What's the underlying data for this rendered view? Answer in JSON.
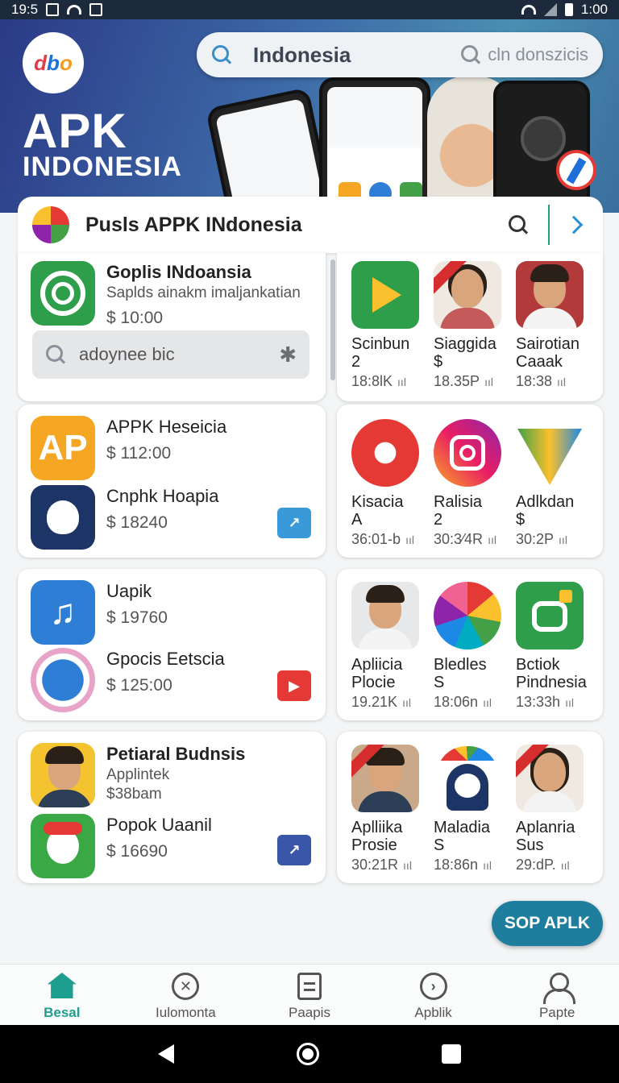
{
  "status_bar": {
    "time": "19:5",
    "right_text": "1:00"
  },
  "header": {
    "brand_line1": "APK",
    "brand_line2": "INDONESIA",
    "logo_text": [
      "d",
      "b",
      "o"
    ],
    "search": {
      "value": "Indonesia",
      "hint": "cln donszicis"
    }
  },
  "title_card": {
    "title": "Pusls APPK INdonesia"
  },
  "featured": {
    "name": "Goplis INdoansia",
    "subtitle": "Saplds ainakm imaljankatian",
    "price": "$  10:00",
    "search_value": "adoynee bic"
  },
  "left_cards": [
    {
      "apps": [
        {
          "name": "APPK Heseicia",
          "price": "$ 112:00",
          "icon": "ap-letters-icon",
          "color": "#f5a623"
        },
        {
          "name": "Cnphk Hoapia",
          "price": "$ 18240",
          "icon": "apple-icon",
          "color": "#1c3566"
        }
      ],
      "button_icon": "trend-icon",
      "button_color": "#3a9ad9"
    },
    {
      "apps": [
        {
          "name": "Uapik",
          "price": "$ 19760",
          "icon": "music-note-icon",
          "color": "#2e7ed6"
        },
        {
          "name": "Gpocis Eetscia",
          "price": "$ 125:00",
          "icon": "compass-icon",
          "color": "#e8eef4"
        }
      ],
      "button_icon": "play-icon",
      "button_color": "#e53935"
    },
    {
      "apps": [
        {
          "name": "Petiaral Budnsis",
          "sub1": "Applintek",
          "sub2": "$38bam",
          "icon": "person-icon",
          "color": "#f4c430"
        },
        {
          "name": "Popok Uaanil",
          "price": "$ 16690",
          "icon": "mascot-icon",
          "color": "#3aa845"
        }
      ],
      "button_icon": "trend-icon",
      "button_color": "#3a56a8"
    }
  ],
  "right_grids": [
    [
      {
        "name1": "Scinbun",
        "name2": "2",
        "stat": "18:8lK",
        "icon": "play-store-icon"
      },
      {
        "name1": "Siaggida",
        "name2": "$",
        "stat": "18.35P",
        "icon": "woman-portrait-icon"
      },
      {
        "name1": "Sairotian",
        "name2": "Caaak",
        "stat": "18:38",
        "icon": "man-portrait-icon"
      }
    ],
    [
      {
        "name1": "Kisacia",
        "name2": "A",
        "stat": "36:01-b",
        "icon": "camera-icon"
      },
      {
        "name1": "Ralisia",
        "name2": "2",
        "stat": "30:3⁄4R",
        "icon": "instagram-icon"
      },
      {
        "name1": "Adlkdan",
        "name2": "$",
        "stat": "30:2P",
        "icon": "triangle-icon"
      }
    ],
    [
      {
        "name1": "Apliicia",
        "name2": "Plocie",
        "stat": "19.21K",
        "icon": "man-portrait-icon"
      },
      {
        "name1": "Bledles",
        "name2": "S",
        "stat": "18:06n",
        "icon": "pinwheel-icon"
      },
      {
        "name1": "Bctiok",
        "name2": "Pindnesia",
        "stat": "13:33h",
        "icon": "link-icon"
      }
    ],
    [
      {
        "name1": "Aplliika",
        "name2": "Prosie",
        "stat": "30:21R",
        "icon": "man-portrait-icon"
      },
      {
        "name1": "Maladia",
        "name2": "S",
        "stat": "18:86n",
        "icon": "penguin-icon"
      },
      {
        "name1": "Aplanria",
        "name2": "Sus",
        "stat": "29:dP.",
        "icon": "woman-portrait-icon"
      }
    ]
  ],
  "bars_glyph": "ııl",
  "fab": {
    "label": "SOP APLK"
  },
  "bottom_nav": [
    {
      "label": "Besal",
      "icon": "home-icon"
    },
    {
      "label": "Iulomonta",
      "icon": "cross-circle-icon"
    },
    {
      "label": "Paapis",
      "icon": "document-icon"
    },
    {
      "label": "Apblik",
      "icon": "arrow-circle-icon"
    },
    {
      "label": "Papte",
      "icon": "user-icon"
    }
  ],
  "colors": {
    "accent": "#1e9e8e",
    "header_start": "#2b3a86",
    "fab": "#1f7e9e"
  }
}
